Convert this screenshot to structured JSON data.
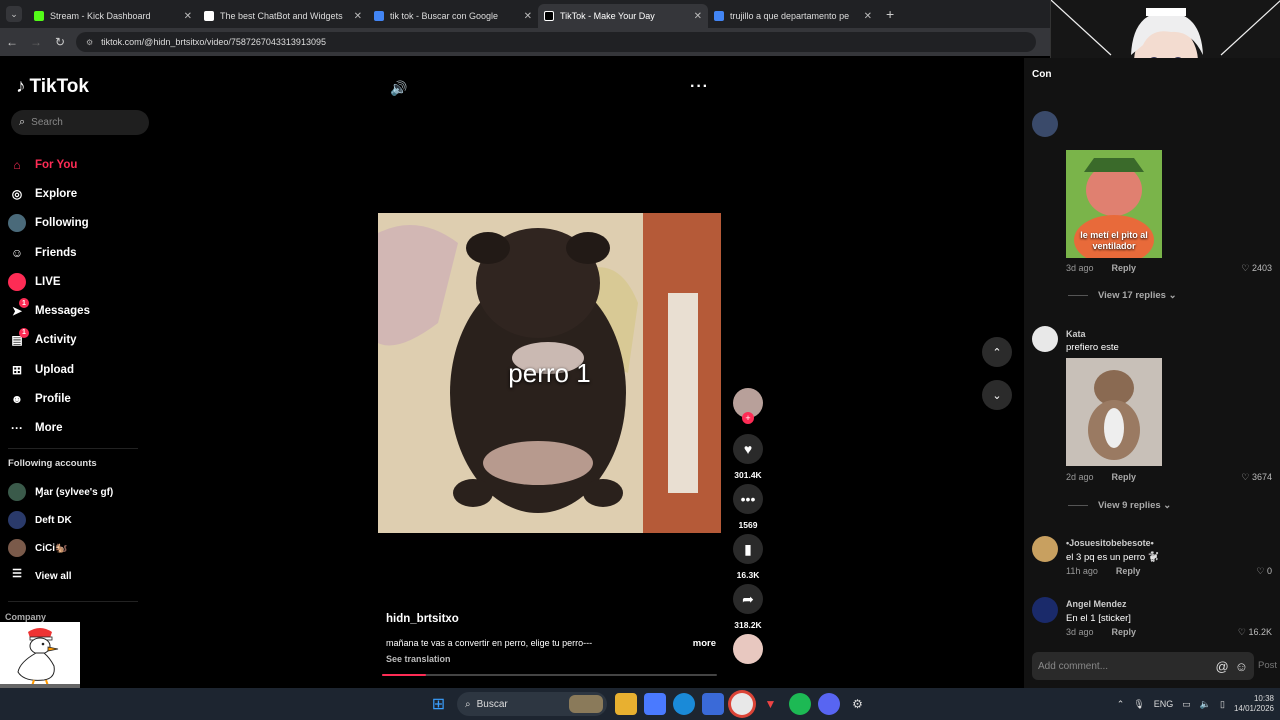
{
  "browser": {
    "tabs": [
      {
        "title": "Stream - Kick Dashboard",
        "color": "#53fc18",
        "active": false
      },
      {
        "title": "The best ChatBot and Widgets",
        "color": "#ffffff",
        "active": false
      },
      {
        "title": "tik tok - Buscar con Google",
        "color": "#4285f4",
        "active": false
      },
      {
        "title": "TikTok - Make Your Day",
        "color": "#000000",
        "active": true
      },
      {
        "title": "trujillo a que departamento pe",
        "color": "#4285f4",
        "active": false
      }
    ],
    "url": "tiktok.com/@hidn_brtsitxo/video/7587267043313913095"
  },
  "sidebar": {
    "logo": "TikTok",
    "search_placeholder": "Search",
    "items": [
      {
        "label": "For You",
        "icon": "home-icon",
        "badge": ""
      },
      {
        "label": "Explore",
        "icon": "compass-icon",
        "badge": ""
      },
      {
        "label": "Following",
        "icon": "following-avatar-icon",
        "badge": ""
      },
      {
        "label": "Friends",
        "icon": "friends-icon",
        "badge": ""
      },
      {
        "label": "LIVE",
        "icon": "live-icon",
        "badge": ""
      },
      {
        "label": "Messages",
        "icon": "messages-icon",
        "badge": "1"
      },
      {
        "label": "Activity",
        "icon": "activity-icon",
        "badge": "1"
      },
      {
        "label": "Upload",
        "icon": "upload-icon",
        "badge": ""
      },
      {
        "label": "Profile",
        "icon": "profile-icon",
        "badge": ""
      },
      {
        "label": "More",
        "icon": "more-icon",
        "badge": ""
      }
    ],
    "following_title": "Following accounts",
    "following": [
      {
        "name": "Ɱar (sylvee's gf)",
        "color": "#3a5a4a"
      },
      {
        "name": "Deft DK",
        "color": "#2a3a6a"
      },
      {
        "name": "CiCi🐿️",
        "color": "#7a5a4a"
      }
    ],
    "view_all": "View all",
    "company": "Company"
  },
  "video": {
    "caption": "perro 1",
    "author": "hidn_brtsitxo",
    "description": "mañana te vas a convertir en perro, elige tu perro---",
    "more": "more",
    "see_translation": "See translation",
    "progress": 0.13,
    "likes": "301.4K",
    "comments": "1569",
    "saves": "16.3K",
    "shares": "318.2K"
  },
  "comments": {
    "title": "Con",
    "list": [
      {
        "name": "",
        "text": "",
        "time": "3d ago",
        "reply": "Reply",
        "likes": "2403",
        "image_text": "le metí el pito al ventilador",
        "view_replies": "View 17 replies"
      },
      {
        "name": "Kata",
        "text": "prefiero este",
        "time": "2d ago",
        "reply": "Reply",
        "likes": "3674",
        "view_replies": "View 9 replies"
      },
      {
        "name": "•Josuesitobebesote•",
        "text": "el 3 pq es un perro 🐩",
        "time": "11h ago",
        "reply": "Reply",
        "likes": "0"
      },
      {
        "name": "Angel Mendez",
        "text": "En el 1 [sticker]",
        "time": "3d ago",
        "reply": "Reply",
        "likes": "16.2K"
      }
    ],
    "add_placeholder": "Add comment...",
    "post": "Post"
  },
  "taskbar": {
    "search": "Buscar",
    "lang": "ENG",
    "time": "10:38",
    "date": "14/01/2026"
  }
}
